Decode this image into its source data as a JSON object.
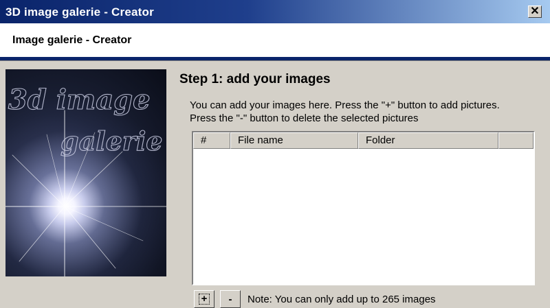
{
  "window": {
    "title": "3D image galerie - Creator",
    "close_label": "✕"
  },
  "header": {
    "title": "Image galerie - Creator"
  },
  "preview": {
    "line1": "3d image",
    "line2": "galerie"
  },
  "step": {
    "title": "Step 1: add your images",
    "description": "You can add your images here. Press the \"+\" button to add pictures. Press the \"-\" button to delete the selected pictures"
  },
  "list": {
    "columns": [
      "#",
      "File name",
      "Folder",
      ""
    ],
    "rows": []
  },
  "buttons": {
    "add_label": "+",
    "remove_label": "-"
  },
  "note": "Note: You can only add up to 265 images",
  "colors": {
    "titlebar": "#0a246a",
    "face": "#d4d0c8",
    "header_line": "#0a246a"
  }
}
